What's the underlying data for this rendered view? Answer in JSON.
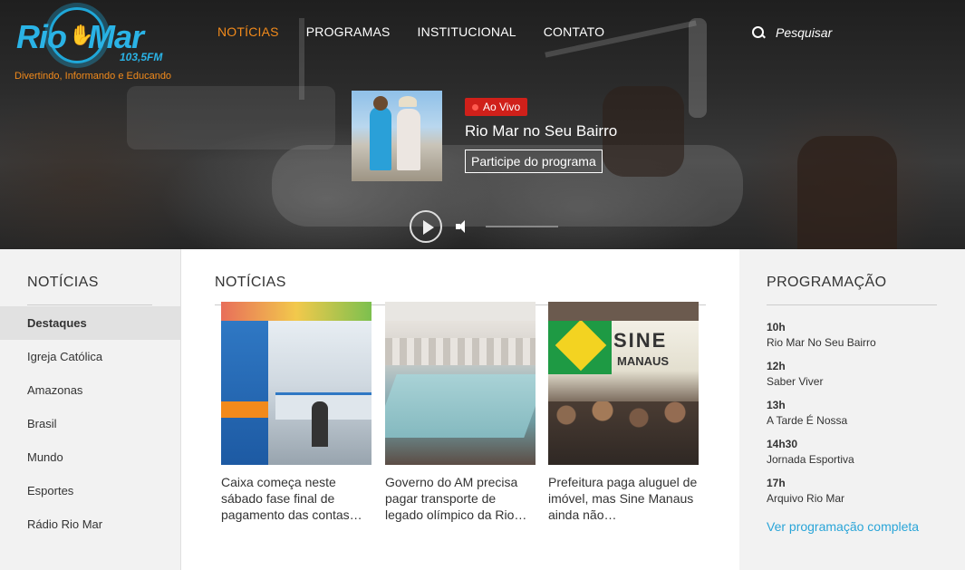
{
  "brand": {
    "name_left": "Rio",
    "name_right": "Mar",
    "frequency": "103,5FM",
    "slogan": "Divertindo, Informando e Educando",
    "colors": {
      "blue": "#2ab3e6",
      "orange": "#f28a1b"
    }
  },
  "nav": {
    "items": [
      {
        "label": "NOTÍCIAS",
        "active": true
      },
      {
        "label": "PROGRAMAS"
      },
      {
        "label": "INSTITUCIONAL"
      },
      {
        "label": "CONTATO"
      }
    ],
    "active_color": "#f28a1b"
  },
  "search": {
    "label": "Pesquisar",
    "icon": "search-icon"
  },
  "now_playing": {
    "badge": "Ao Vivo",
    "badge_color": "#d0201a",
    "program": "Rio Mar no Seu Bairro",
    "cta": "Participe do programa"
  },
  "player": {
    "play_icon": "play-icon",
    "volume_icon": "volume-icon"
  },
  "left_sidebar": {
    "title": "NOTÍCIAS",
    "items": [
      {
        "label": "Destaques",
        "active": true
      },
      {
        "label": "Igreja Católica"
      },
      {
        "label": "Amazonas"
      },
      {
        "label": "Brasil"
      },
      {
        "label": "Mundo"
      },
      {
        "label": "Esportes"
      },
      {
        "label": "Rádio Rio Mar"
      }
    ]
  },
  "main": {
    "title": "NOTÍCIAS",
    "cards": [
      {
        "title": "Caixa começa neste sábado fase final de pagamento das contas…",
        "image": "bank-counter-photo"
      },
      {
        "title": "Governo do AM precisa pagar transporte de legado olímpico da Rio…",
        "image": "pool-photo"
      },
      {
        "title": "Prefeitura paga aluguel de imóvel, mas Sine Manaus ainda não…",
        "image": "sine-manaus-crowd-photo",
        "sign_line1": "SINE",
        "sign_line2": "MANAUS"
      }
    ]
  },
  "right_sidebar": {
    "title": "PROGRAMAÇÃO",
    "schedule": [
      {
        "time": "10h",
        "program": "Rio Mar No Seu Bairro"
      },
      {
        "time": "12h",
        "program": "Saber Viver"
      },
      {
        "time": "13h",
        "program": "A Tarde É Nossa"
      },
      {
        "time": "14h30",
        "program": "Jornada Esportiva"
      },
      {
        "time": "17h",
        "program": "Arquivo Rio Mar"
      }
    ],
    "full_link": "Ver programação completa",
    "link_color": "#2aa5d8"
  }
}
